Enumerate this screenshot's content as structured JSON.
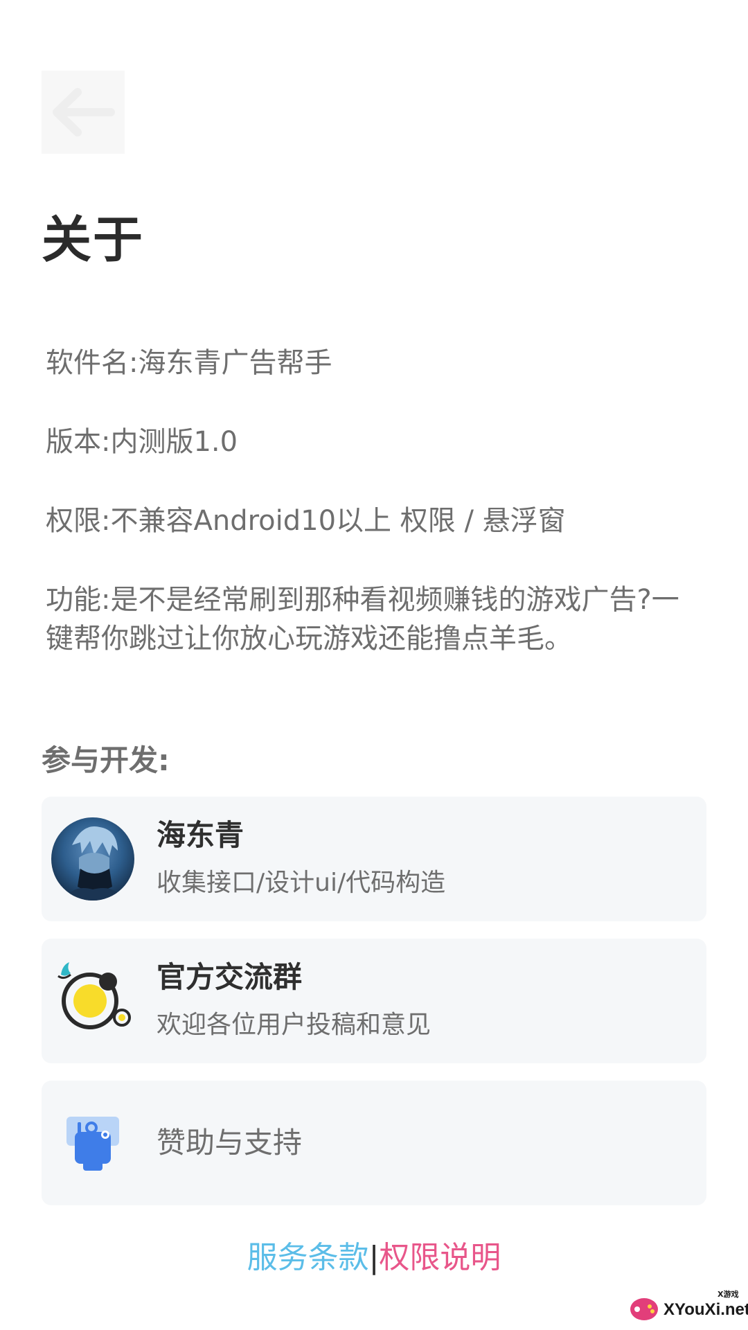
{
  "header": {
    "back_icon": "arrow-left-icon",
    "title": "关于"
  },
  "info": {
    "name": "软件名:海东青广告帮手",
    "version": "版本:内测版1.0",
    "permission": "权限:不兼容Android10以上 权限 / 悬浮窗",
    "feature": "功能:是不是经常刷到那种看视频赚钱的游戏广告?一键帮你跳过让你放心玩游戏还能撸点羊毛。"
  },
  "contributors": {
    "section_title": "参与开发:",
    "developer": {
      "name": "海东青",
      "role": "收集接口/设计ui/代码构造",
      "icon": "avatar"
    },
    "group": {
      "title": "官方交流群",
      "subtitle": "欢迎各位用户投稿和意见",
      "icon": "planet-icon"
    },
    "sponsor": {
      "label": "赞助与支持",
      "icon": "sponsor-icon"
    }
  },
  "footer": {
    "terms_label": "服务条款",
    "separator": "|",
    "permission_label": "权限说明"
  },
  "watermark": {
    "text": "XYouXi.net",
    "small": "X游戏"
  },
  "colors": {
    "terms_link": "#5bbde8",
    "permission_link": "#e8568a",
    "card_background": "#f5f7f9",
    "sponsor_icon": "#3f7de8",
    "planet_yellow": "#f8dc2a"
  }
}
